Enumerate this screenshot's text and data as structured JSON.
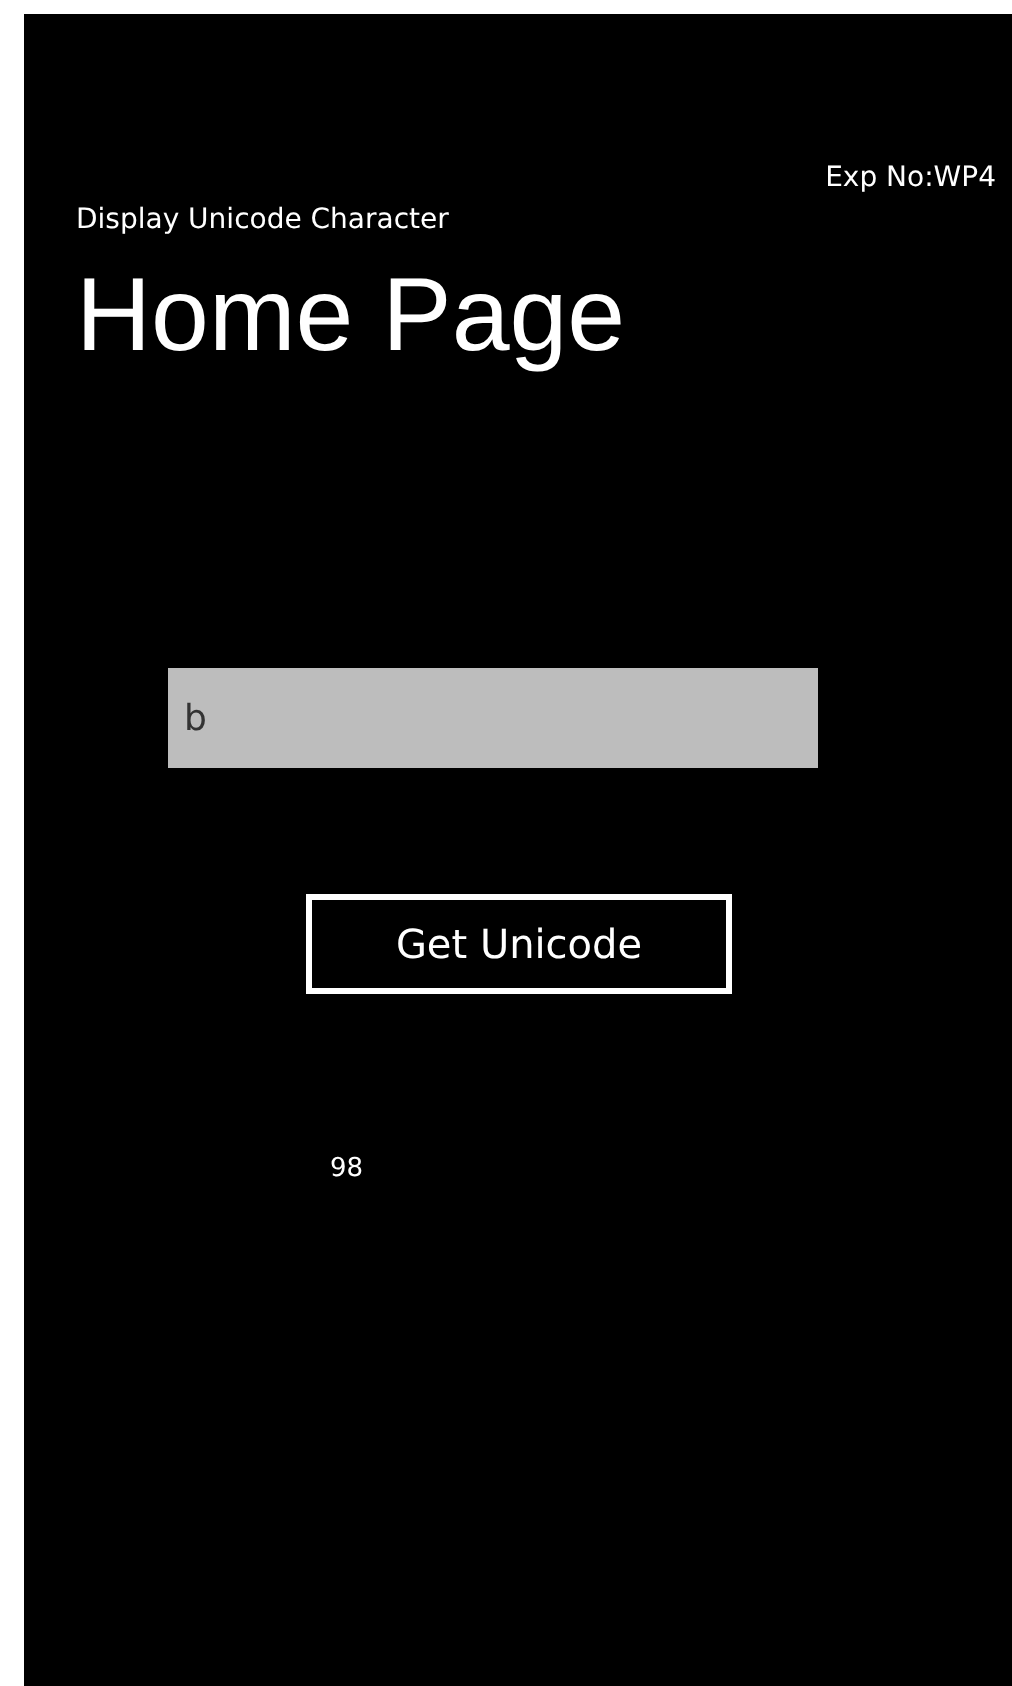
{
  "experiment_label": "Exp No:WP4",
  "app_title": "Display Unicode Character",
  "page_title": "Home Page",
  "input": {
    "value": "b"
  },
  "button": {
    "label": "Get Unicode"
  },
  "result": "98"
}
